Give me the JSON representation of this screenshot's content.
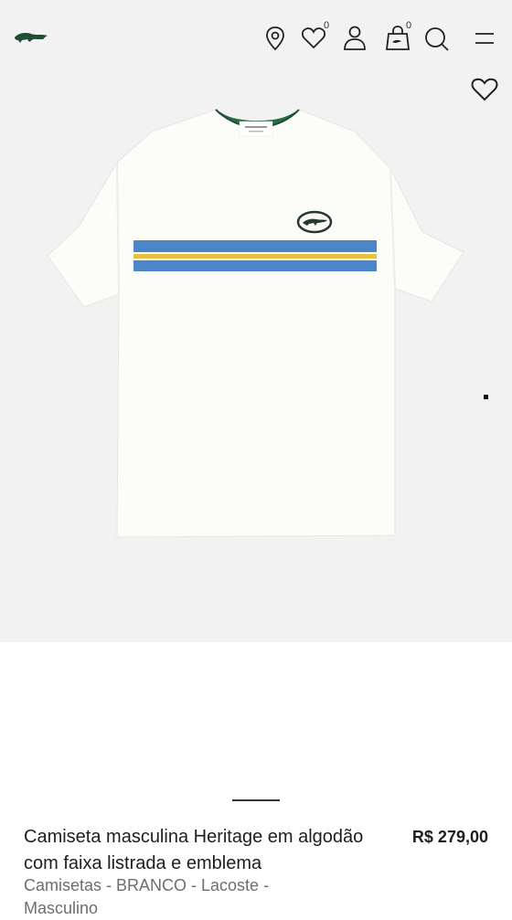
{
  "header": {
    "logo_icon": "lacoste-crocodile-logo",
    "icons": [
      "location-pin-icon",
      "heart-icon",
      "user-icon",
      "shopping-bag-icon",
      "search-icon",
      "menu-icon"
    ],
    "wishlist_count": "0",
    "cart_count": "0"
  },
  "product": {
    "title": "Camiseta masculina Heritage em algodão com faixa listrada e emblema",
    "price": "R$ 279,00",
    "subtitle": "Camisetas - BRANCO - Lacoste - Masculino",
    "image_icon": "white-tshirt-blue-yellow-stripe"
  },
  "colors": {
    "brand_green": "#1f4d36",
    "stripe_blue": "#4c86c8",
    "stripe_yellow": "#e7c13f",
    "background_gray": "#f2f2f2"
  }
}
